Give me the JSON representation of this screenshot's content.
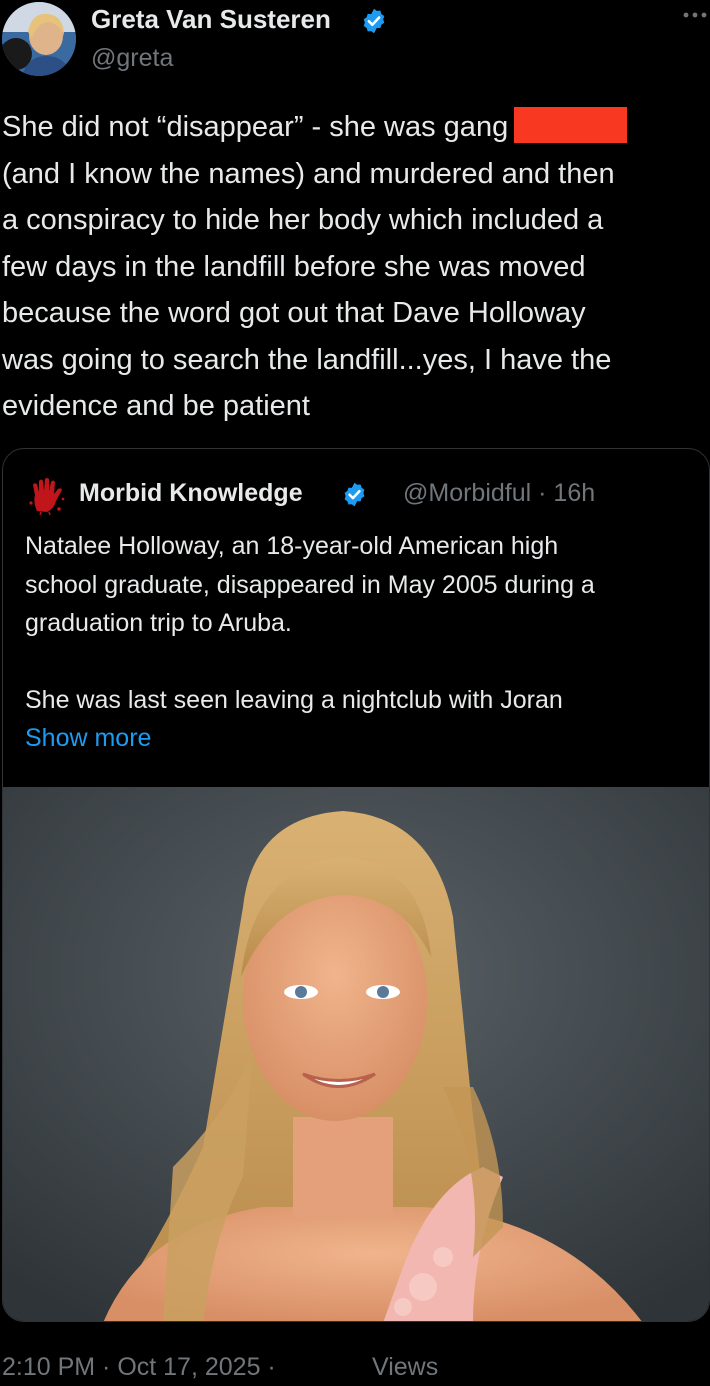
{
  "author": {
    "name": "Greta Van Susteren",
    "handle": "@greta",
    "verified": true,
    "avatar_icon": "avatar-photo"
  },
  "tweet": {
    "lines": [
      "She did not “disappear” - she was gang",
      "(and I know the names) and murdered and then",
      "a conspiracy to hide her body which included a",
      "few days in the landfill before she was moved",
      "because the word got out that Dave Holloway",
      "was going to search the landfill...yes, I have the",
      "evidence and be patient"
    ],
    "redaction_color": "#f93822"
  },
  "quote": {
    "author_name": "Morbid Knowledge",
    "verified": true,
    "handle_time": "@Morbidful · 16h",
    "paragraph1": [
      "Natalee Holloway, an 18-year-old American high",
      "school graduate, disappeared in May 2005 during a",
      "graduation trip to Aruba."
    ],
    "paragraph2": [
      "She was last seen leaving a nightclub with Joran"
    ],
    "show_more": "Show more",
    "logo_icon": "bloody-hand-icon",
    "media_icon": "portrait-photo"
  },
  "footer": {
    "timestamp": "2:10 PM · Oct 17, 2025 ·",
    "views": "Views"
  },
  "colors": {
    "background": "#000000",
    "text": "#e7e9ea",
    "secondary_text": "#71767b",
    "accent": "#1d9bf0",
    "border": "#2f3336"
  }
}
